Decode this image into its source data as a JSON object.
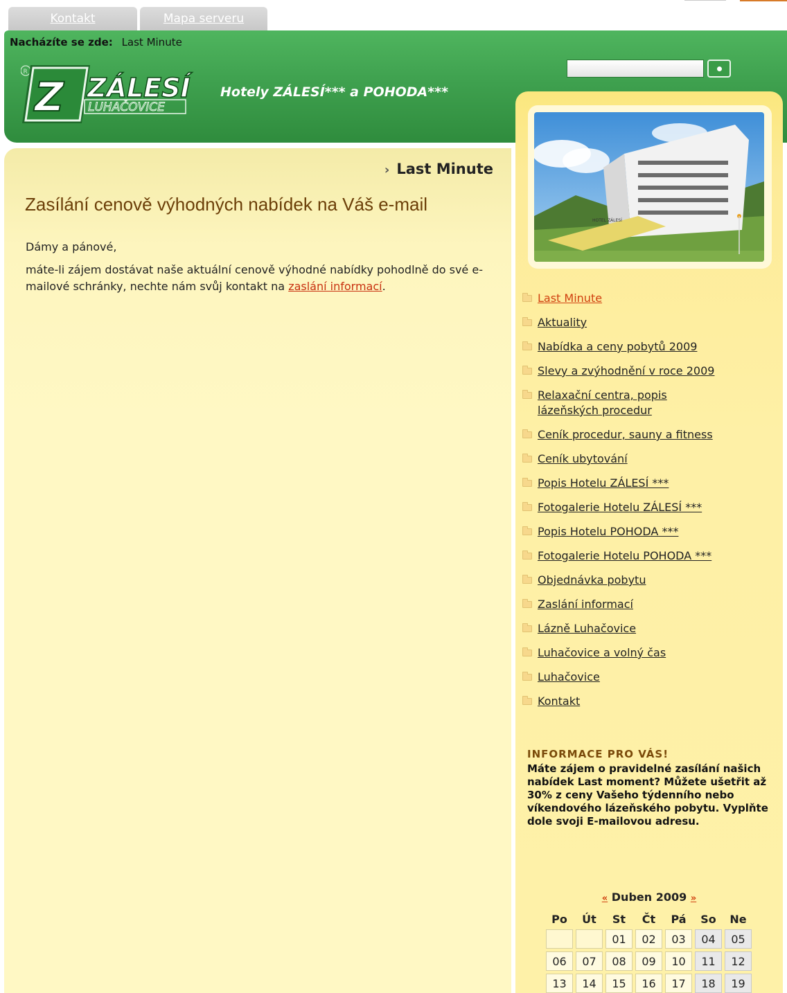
{
  "top_tabs": [
    {
      "label": "Kontakt"
    },
    {
      "label": "Mapa serveru"
    }
  ],
  "breadcrumb": {
    "prefix": "Nacházíte se zde:",
    "current": "Last Minute"
  },
  "logo": {
    "text": "ZÁLESÍ",
    "subtext": "LUHAČOVICE",
    "mark": "Z"
  },
  "header": {
    "tagline": "Hotely ZÁLESÍ*** a POHODA***"
  },
  "search": {
    "value": "",
    "button_icon": "dot-icon"
  },
  "main": {
    "heading": "Last Minute",
    "title": "Zasílání cenově výhodných nabídek na Váš e-mail",
    "greeting": "Dámy a pánové,",
    "paragraph_start": "máte-li zájem dostávat naše aktuální cenově výhodné nabídky pohodlně do své e-mailové schránky, nechte nám svůj kontakt na ",
    "paragraph_link": "zaslání informací",
    "paragraph_end": "."
  },
  "photo": {
    "sign_text": "HOTEL ZÁLESÍ"
  },
  "menu": {
    "items": [
      {
        "label": "Last Minute",
        "active": true
      },
      {
        "label": "Aktuality"
      },
      {
        "label": "Nabídka a ceny pobytů 2009"
      },
      {
        "label": "Slevy a zvýhodnění v roce 2009"
      },
      {
        "label": "Relaxační centra, popis lázeňských procedur"
      },
      {
        "label": "Ceník procedur, sauny a fitness"
      },
      {
        "label": "Ceník ubytování"
      },
      {
        "label": "Popis Hotelu ZÁLESÍ ***"
      },
      {
        "label": "Fotogalerie Hotelu ZÁLESÍ ***"
      },
      {
        "label": "Popis Hotelu POHODA ***"
      },
      {
        "label": "Fotogalerie Hotelu POHODA ***"
      },
      {
        "label": "Objednávka pobytu"
      },
      {
        "label": "Zaslání informací"
      },
      {
        "label": "Lázně Luhačovice"
      },
      {
        "label": "Luhačovice a volný čas"
      },
      {
        "label": "Luhačovice"
      },
      {
        "label": "Kontakt"
      }
    ]
  },
  "info": {
    "title": "INFORMACE PRO VÁS!",
    "text": "Máte zájem o pravidelné zasílání našich nabídek Last moment? Můžete ušetřit až 30% z ceny Vašeho týdenního nebo víkendového lázeňského pobytu. Vyplňte dole svoji E-mailovou adresu."
  },
  "calendar": {
    "prev": "«",
    "next": "»",
    "month": "Duben 2009",
    "days": [
      "Po",
      "Út",
      "St",
      "Čt",
      "Pá",
      "So",
      "Ne"
    ],
    "weeks": [
      [
        "",
        "",
        "01",
        "02",
        "03",
        "04",
        "05"
      ],
      [
        "06",
        "07",
        "08",
        "09",
        "10",
        "11",
        "12"
      ],
      [
        "13",
        "14",
        "15",
        "16",
        "17",
        "18",
        "19"
      ]
    ]
  }
}
